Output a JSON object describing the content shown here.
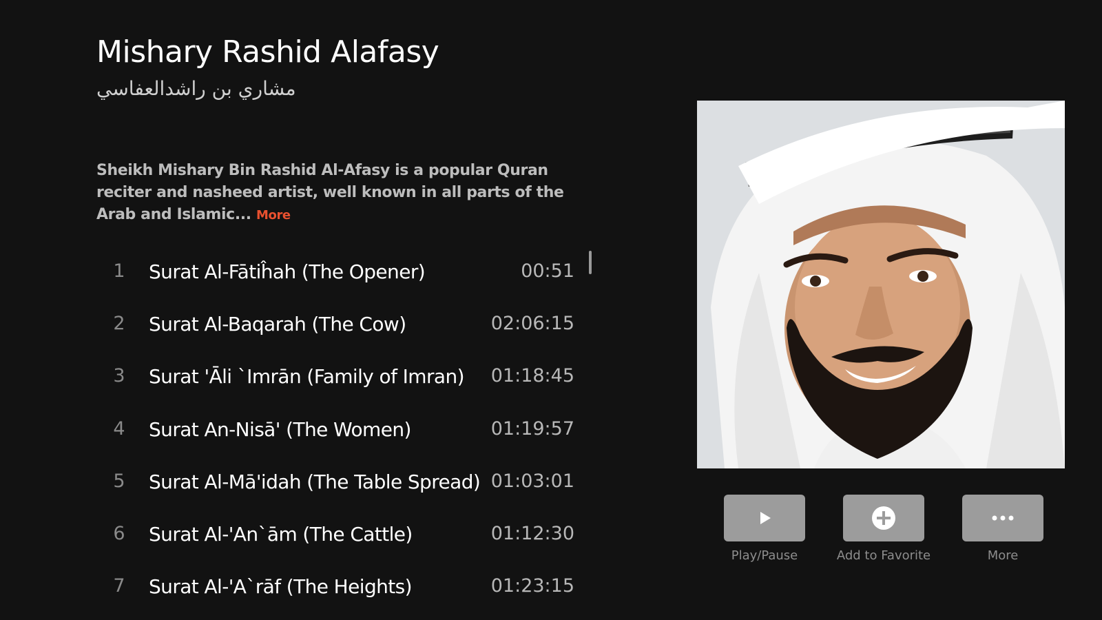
{
  "artist": {
    "name": "Mishary Rashid Alafasy",
    "name_arabic": "مشاري بن راشدالعفاسي",
    "description": "Sheikh Mishary Bin Rashid Al-Afasy is a popular Quran reciter and nasheed artist, well known in all parts of the Arab and Islamic...",
    "more_label": "More",
    "more_color": "#e8502f"
  },
  "tracks": [
    {
      "num": "1",
      "title": "Surat Al-Fātiĥah (The Opener)",
      "duration": "00:51"
    },
    {
      "num": "2",
      "title": "Surat Al-Baqarah (The Cow)",
      "duration": "02:06:15"
    },
    {
      "num": "3",
      "title": "Surat 'Āli `Imrān (Family of Imran)",
      "duration": "01:18:45"
    },
    {
      "num": "4",
      "title": "Surat An-Nisā' (The Women)",
      "duration": "01:19:57"
    },
    {
      "num": "5",
      "title": "Surat Al-Mā'idah (The Table Spread)",
      "duration": "01:03:01"
    },
    {
      "num": "6",
      "title": "Surat Al-'An`ām (The Cattle)",
      "duration": "01:12:30"
    },
    {
      "num": "7",
      "title": "Surat Al-'A`rāf (The Heights)",
      "duration": "01:23:15"
    }
  ],
  "actions": [
    {
      "label": "Play/Pause",
      "icon": "play-icon"
    },
    {
      "label": "Add to Favorite",
      "icon": "add-circle-icon"
    },
    {
      "label": "More",
      "icon": "more-horizontal-icon"
    }
  ],
  "colors": {
    "background": "#121212",
    "button": "#9c9c9c"
  }
}
